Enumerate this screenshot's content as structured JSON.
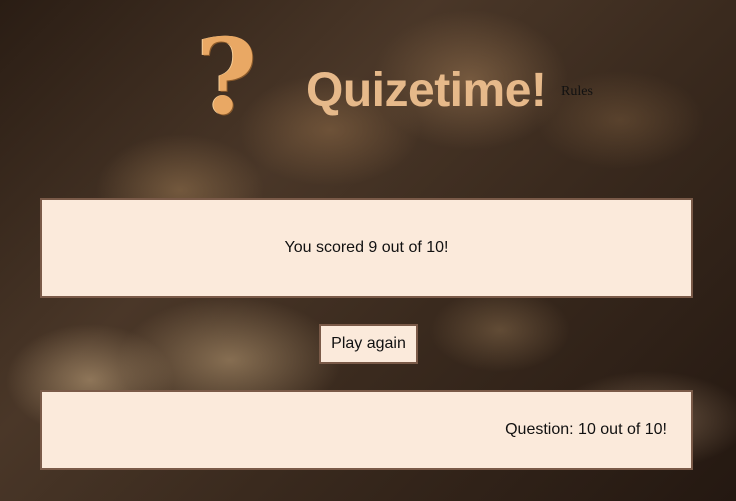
{
  "header": {
    "logo_glyph": "?",
    "title": "Quizetime!",
    "rules_link": "Rules",
    "title_color": "#e6b98a",
    "logo_color": "#e9a864"
  },
  "result": {
    "score_text": "You scored 9 out of 10!"
  },
  "actions": {
    "play_again_label": "Play again"
  },
  "progress": {
    "question_text": "Question: 10 out of 10!"
  },
  "colors": {
    "panel_background": "#fbeadb",
    "panel_border": "#7a5a48"
  }
}
